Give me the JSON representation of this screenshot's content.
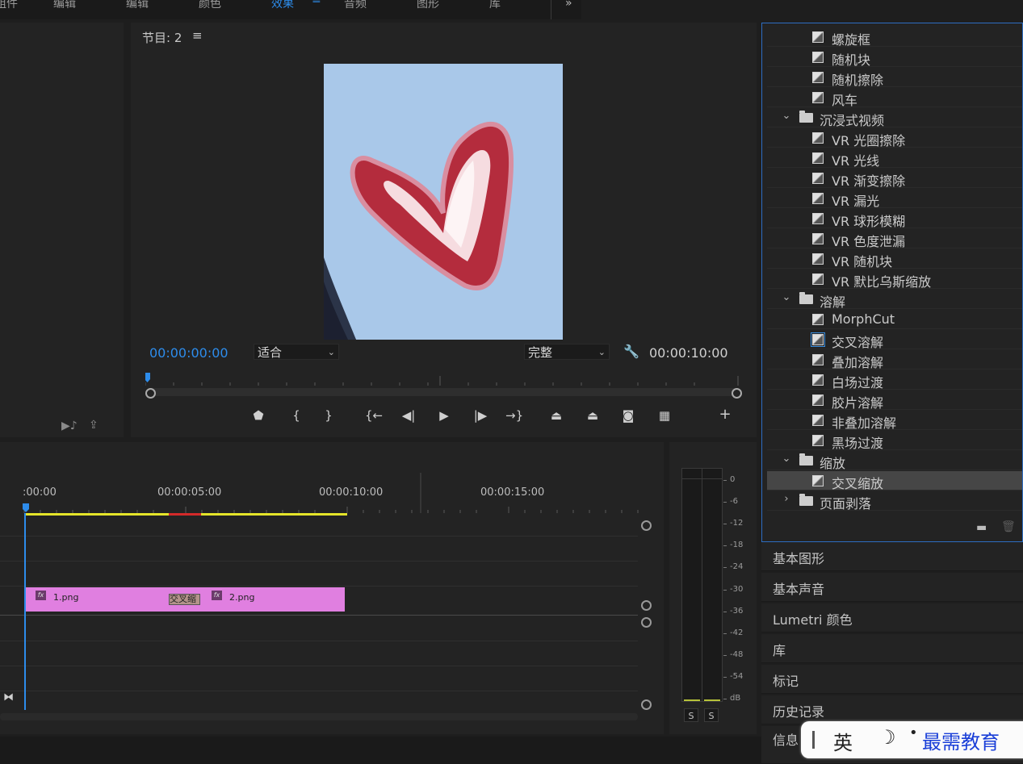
{
  "workspace_tabs": [
    {
      "label": "组件"
    },
    {
      "label": "编辑"
    },
    {
      "label": "颜色"
    },
    {
      "label": "效果"
    },
    {
      "label": "音频"
    },
    {
      "label": "图形"
    },
    {
      "label": "库"
    }
  ],
  "workspace_active": "效果",
  "program": {
    "title": "节目: 2",
    "current_timecode": "00:00:00:00",
    "zoom_select": "适合",
    "quality_select": "完整",
    "duration_timecode": "00:00:10:00"
  },
  "timeline": {
    "ruler_labels": [
      ":00:00",
      "00:00:05:00",
      "00:00:10:00",
      "00:00:15:00"
    ],
    "clips": [
      {
        "name": "1.png",
        "fx": "fx"
      },
      {
        "name": "2.png",
        "fx": "fx"
      }
    ],
    "transition_label": "交叉缩",
    "colors": {
      "clip": "#e07fe0",
      "work_area": "#e5e52a",
      "render_red": "#d42a2a",
      "playhead": "#2d8ceb"
    }
  },
  "audio_meter": {
    "scale": [
      "0",
      "-6",
      "-12",
      "-18",
      "-24",
      "-30",
      "-36",
      "-42",
      "-48",
      "-54",
      "dB"
    ],
    "solo_buttons": [
      "S",
      "S"
    ]
  },
  "effects_tree": [
    {
      "type": "effect",
      "label": "螺旋框"
    },
    {
      "type": "effect",
      "label": "随机块"
    },
    {
      "type": "effect",
      "label": "随机擦除"
    },
    {
      "type": "effect",
      "label": "风车"
    },
    {
      "type": "folder",
      "label": "沉浸式视频",
      "expanded": true
    },
    {
      "type": "effect",
      "label": "VR 光圈擦除"
    },
    {
      "type": "effect",
      "label": "VR 光线"
    },
    {
      "type": "effect",
      "label": "VR 渐变擦除"
    },
    {
      "type": "effect",
      "label": "VR 漏光"
    },
    {
      "type": "effect",
      "label": "VR 球形模糊"
    },
    {
      "type": "effect",
      "label": "VR 色度泄漏"
    },
    {
      "type": "effect",
      "label": "VR 随机块"
    },
    {
      "type": "effect",
      "label": "VR 默比乌斯缩放"
    },
    {
      "type": "folder",
      "label": "溶解",
      "expanded": true
    },
    {
      "type": "effect",
      "label": "MorphCut"
    },
    {
      "type": "effect",
      "label": "交叉溶解",
      "focused": true
    },
    {
      "type": "effect",
      "label": "叠加溶解"
    },
    {
      "type": "effect",
      "label": "白场过渡"
    },
    {
      "type": "effect",
      "label": "胶片溶解"
    },
    {
      "type": "effect",
      "label": "非叠加溶解"
    },
    {
      "type": "effect",
      "label": "黑场过渡"
    },
    {
      "type": "folder",
      "label": "缩放",
      "expanded": true
    },
    {
      "type": "effect",
      "label": "交叉缩放",
      "selected": true
    },
    {
      "type": "folder",
      "label": "页面剥落",
      "expanded": false
    }
  ],
  "collapsed_panels": [
    {
      "label": "基本图形"
    },
    {
      "label": "基本声音"
    },
    {
      "label": "Lumetri 颜色"
    },
    {
      "label": "库"
    },
    {
      "label": "标记"
    },
    {
      "label": "历史记录"
    },
    {
      "label": "信息"
    }
  ],
  "ime": {
    "mode": "英",
    "moon": "☽",
    "dot": "•",
    "brand": "最需教育"
  }
}
